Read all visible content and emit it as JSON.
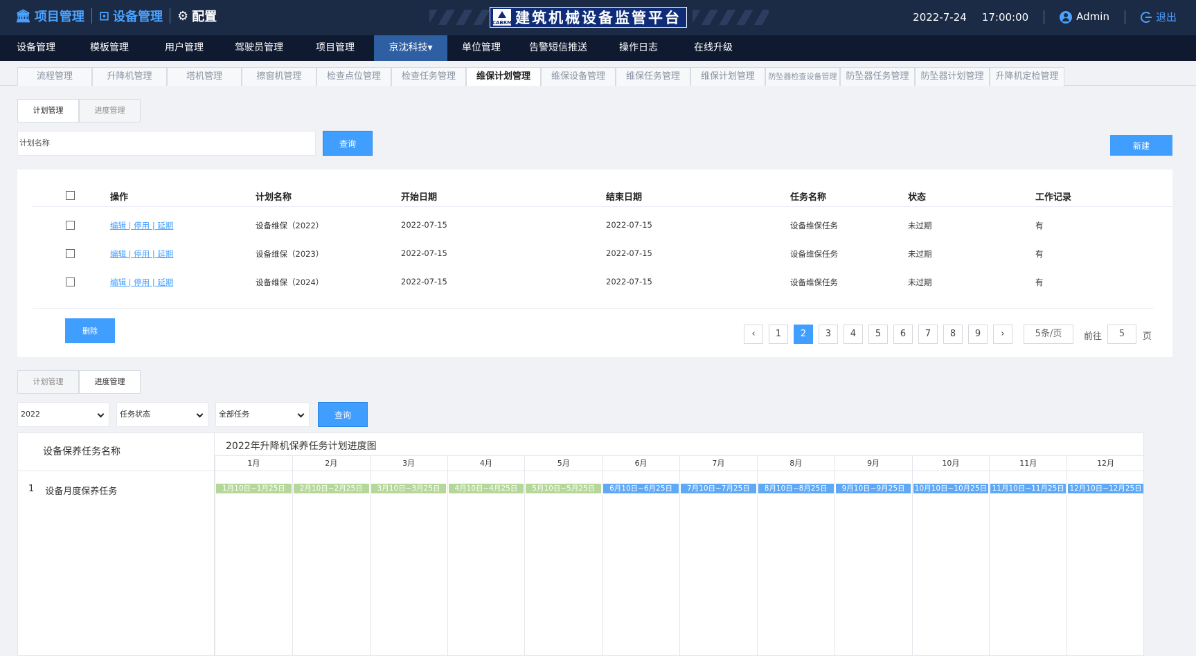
{
  "topbar": {
    "brand_items": [
      "项目管理",
      "设备管理",
      "配置"
    ],
    "platform_title": "建筑机械设备监管平台",
    "platform_logo_text": "CABRM",
    "date": "2022-7-24",
    "time": "17:00:00",
    "user": "Admin",
    "logout": "退出"
  },
  "mainnav": [
    "设备管理",
    "模板管理",
    "用户管理",
    "驾驶员管理",
    "项目管理",
    "京沈科技▾",
    "单位管理",
    "告警短信推送",
    "操作日志",
    "在线升级"
  ],
  "subtabs": [
    "流程管理",
    "升降机管理",
    "塔机管理",
    "擦窗机管理",
    "检查点位管理",
    "检查任务管理",
    "维保计划管理",
    "维保设备管理",
    "维保任务管理",
    "维保计划管理",
    "防坠器检查设备管理",
    "防坠器任务管理",
    "防坠器计划管理",
    "升降机定检管理"
  ],
  "plan_panel": {
    "tabs": [
      "计划管理",
      "进度管理"
    ],
    "search_placeholder": "计划名称",
    "query_label": "查询",
    "new_label": "新建",
    "columns": [
      "操作",
      "计划名称",
      "开始日期",
      "结束日期",
      "任务名称",
      "状态",
      "工作记录"
    ],
    "rows": [
      {
        "ops": "编辑 | 停用 | 延期",
        "name": "设备维保（2022）",
        "start": "2022-07-15",
        "end": "2022-07-15",
        "task": "设备维保任务",
        "status": "未过期",
        "record": "有"
      },
      {
        "ops": "编辑 | 停用 | 延期",
        "name": "设备维保（2023）",
        "start": "2022-07-15",
        "end": "2022-07-15",
        "task": "设备维保任务",
        "status": "未过期",
        "record": "有"
      },
      {
        "ops": "编辑 | 停用 | 延期",
        "name": "设备维保（2024）",
        "start": "2022-07-15",
        "end": "2022-07-15",
        "task": "设备维保任务",
        "status": "未过期",
        "record": "有"
      }
    ],
    "delete_label": "删除",
    "pagination": {
      "prev": "‹",
      "next": "›",
      "pages": [
        "1",
        "2",
        "3",
        "4",
        "5",
        "6",
        "7",
        "8",
        "9"
      ],
      "current": "2",
      "page_size": "5条/页",
      "goto_label": "前往",
      "goto_value": "5",
      "page_unit": "页"
    }
  },
  "progress_panel": {
    "tabs": [
      "计划管理",
      "进度管理"
    ],
    "year": "2022",
    "status": "任务状态",
    "tasks": "全部任务",
    "query_label": "查询",
    "left_header": "设备保养任务名称",
    "chart_title": "2022年升降机保养任务计划进度图",
    "months": [
      "1月",
      "2月",
      "3月",
      "4月",
      "5月",
      "6月",
      "7月",
      "8月",
      "9月",
      "10月",
      "11月",
      "12月"
    ],
    "task_index": "1",
    "task_name": "设备月度保养任务",
    "bars": [
      {
        "label": "1月10日~1月25日",
        "color": "green"
      },
      {
        "label": "2月10日~2月25日",
        "color": "green"
      },
      {
        "label": "3月10日~3月25日",
        "color": "green"
      },
      {
        "label": "4月10日~4月25日",
        "color": "green"
      },
      {
        "label": "5月10日~5月25日",
        "color": "green"
      },
      {
        "label": "6月10日~6月25日",
        "color": "blue"
      },
      {
        "label": "7月10日~7月25日",
        "color": "blue"
      },
      {
        "label": "8月10日~8月25日",
        "color": "blue"
      },
      {
        "label": "9月10日~9月25日",
        "color": "blue"
      },
      {
        "label": "10月10日~10月25日",
        "color": "blue"
      },
      {
        "label": "11月10日~11月25日",
        "color": "blue"
      },
      {
        "label": "12月10日~12月25日",
        "color": "blue"
      }
    ]
  },
  "colors": {
    "accent": "#409eff",
    "topbar": "#1b2a45",
    "nav": "#0f1a30",
    "nav_active": "#2f5fa3",
    "bar_done": "#b5d79a",
    "bar_pending": "#5fa8f5"
  }
}
